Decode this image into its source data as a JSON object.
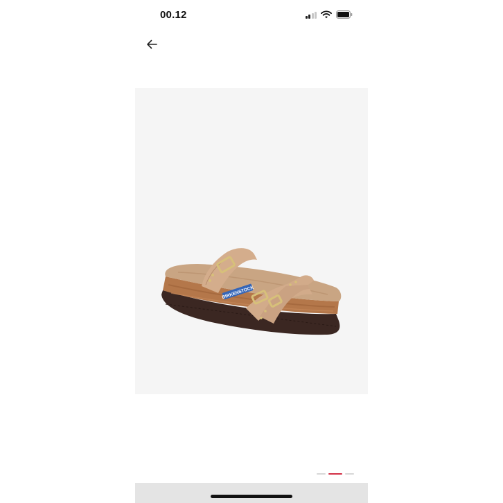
{
  "status_bar": {
    "time": "00.12",
    "icons": [
      "cellular-signal-icon",
      "wifi-icon",
      "battery-icon"
    ],
    "signal_bars_active": 2,
    "signal_bars_total": 4
  },
  "nav": {
    "back_icon": "arrow-left-icon"
  },
  "product_image": {
    "subject": "tan suede double-strap buckle sandal on cork footbed",
    "logo_text": "BIRKENSTOCK",
    "background_color": "#f5f5f5"
  },
  "pager": {
    "total": 3,
    "active_index": 1,
    "active_color": "#d32f45"
  },
  "system": {
    "bottom_bar_color": "#e4e4e4"
  }
}
